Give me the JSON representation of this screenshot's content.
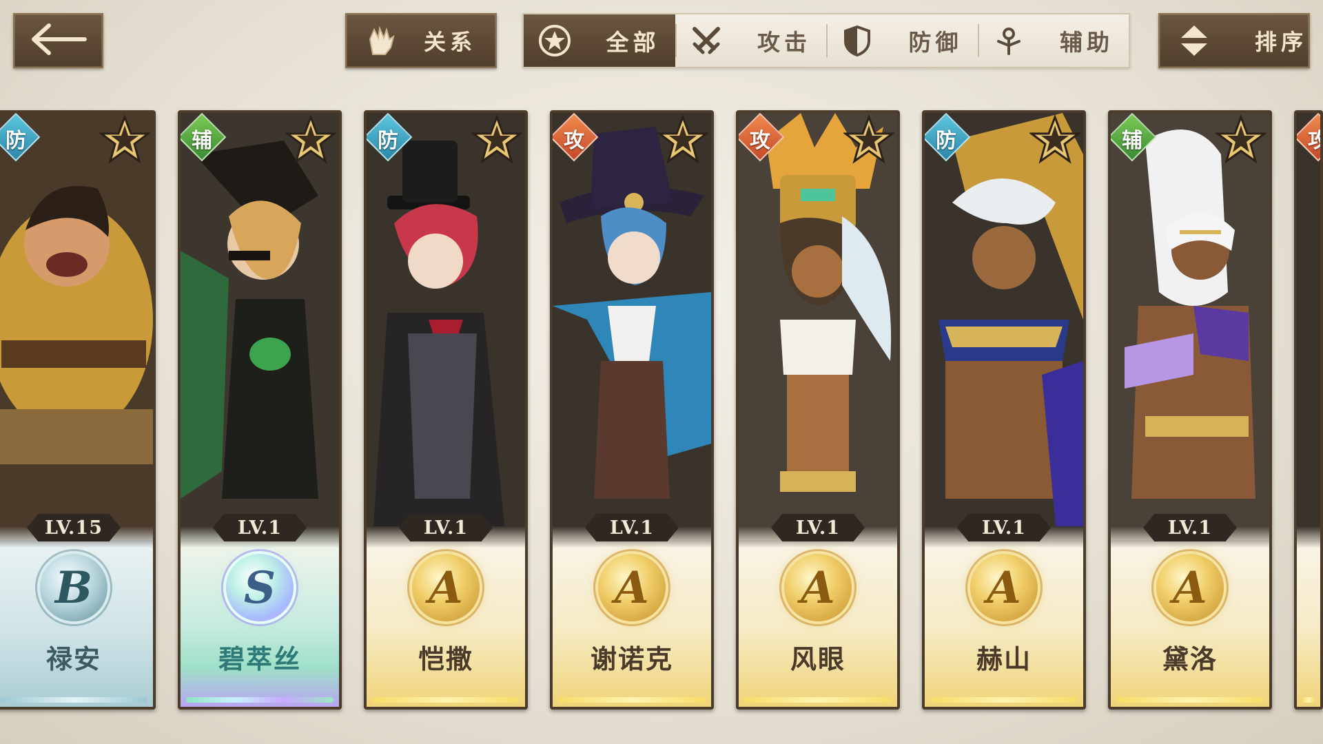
{
  "topbar": {
    "back_icon": "arrow-left-icon",
    "relation_label": "关系",
    "relation_icon": "gauntlet-icon",
    "sort_label": "排序",
    "sort_icon": "sort-arrows-icon"
  },
  "filters": [
    {
      "label": "全部",
      "icon": "star-circle-icon",
      "active": true
    },
    {
      "label": "攻击",
      "icon": "crossed-swords-icon",
      "active": false
    },
    {
      "label": "防御",
      "icon": "shield-icon",
      "active": false
    },
    {
      "label": "辅助",
      "icon": "support-figure-icon",
      "active": false
    }
  ],
  "colors": {
    "dark_button": "#5c4a36",
    "role_defense": "#3aa3c4",
    "role_attack": "#d9623a",
    "role_support": "#55a844",
    "rank_a_gold": "#f0d47a",
    "rank_b_teal": "#a9ccd2"
  },
  "characters": [
    {
      "name": "禄安",
      "role": "防",
      "level": "LV.15",
      "rank": "B",
      "stars": 1
    },
    {
      "name": "碧萃丝",
      "role": "辅",
      "level": "LV.1",
      "rank": "S",
      "stars": 1
    },
    {
      "name": "恺撒",
      "role": "防",
      "level": "LV.1",
      "rank": "A",
      "stars": 1
    },
    {
      "name": "谢诺克",
      "role": "攻",
      "level": "LV.1",
      "rank": "A",
      "stars": 1
    },
    {
      "name": "风眼",
      "role": "攻",
      "level": "LV.1",
      "rank": "A",
      "stars": 1
    },
    {
      "name": "赫山",
      "role": "防",
      "level": "LV.1",
      "rank": "A",
      "stars": 1
    },
    {
      "name": "黛洛",
      "role": "辅",
      "level": "LV.1",
      "rank": "A",
      "stars": 1
    }
  ],
  "partial_card": {
    "role": "攻"
  }
}
